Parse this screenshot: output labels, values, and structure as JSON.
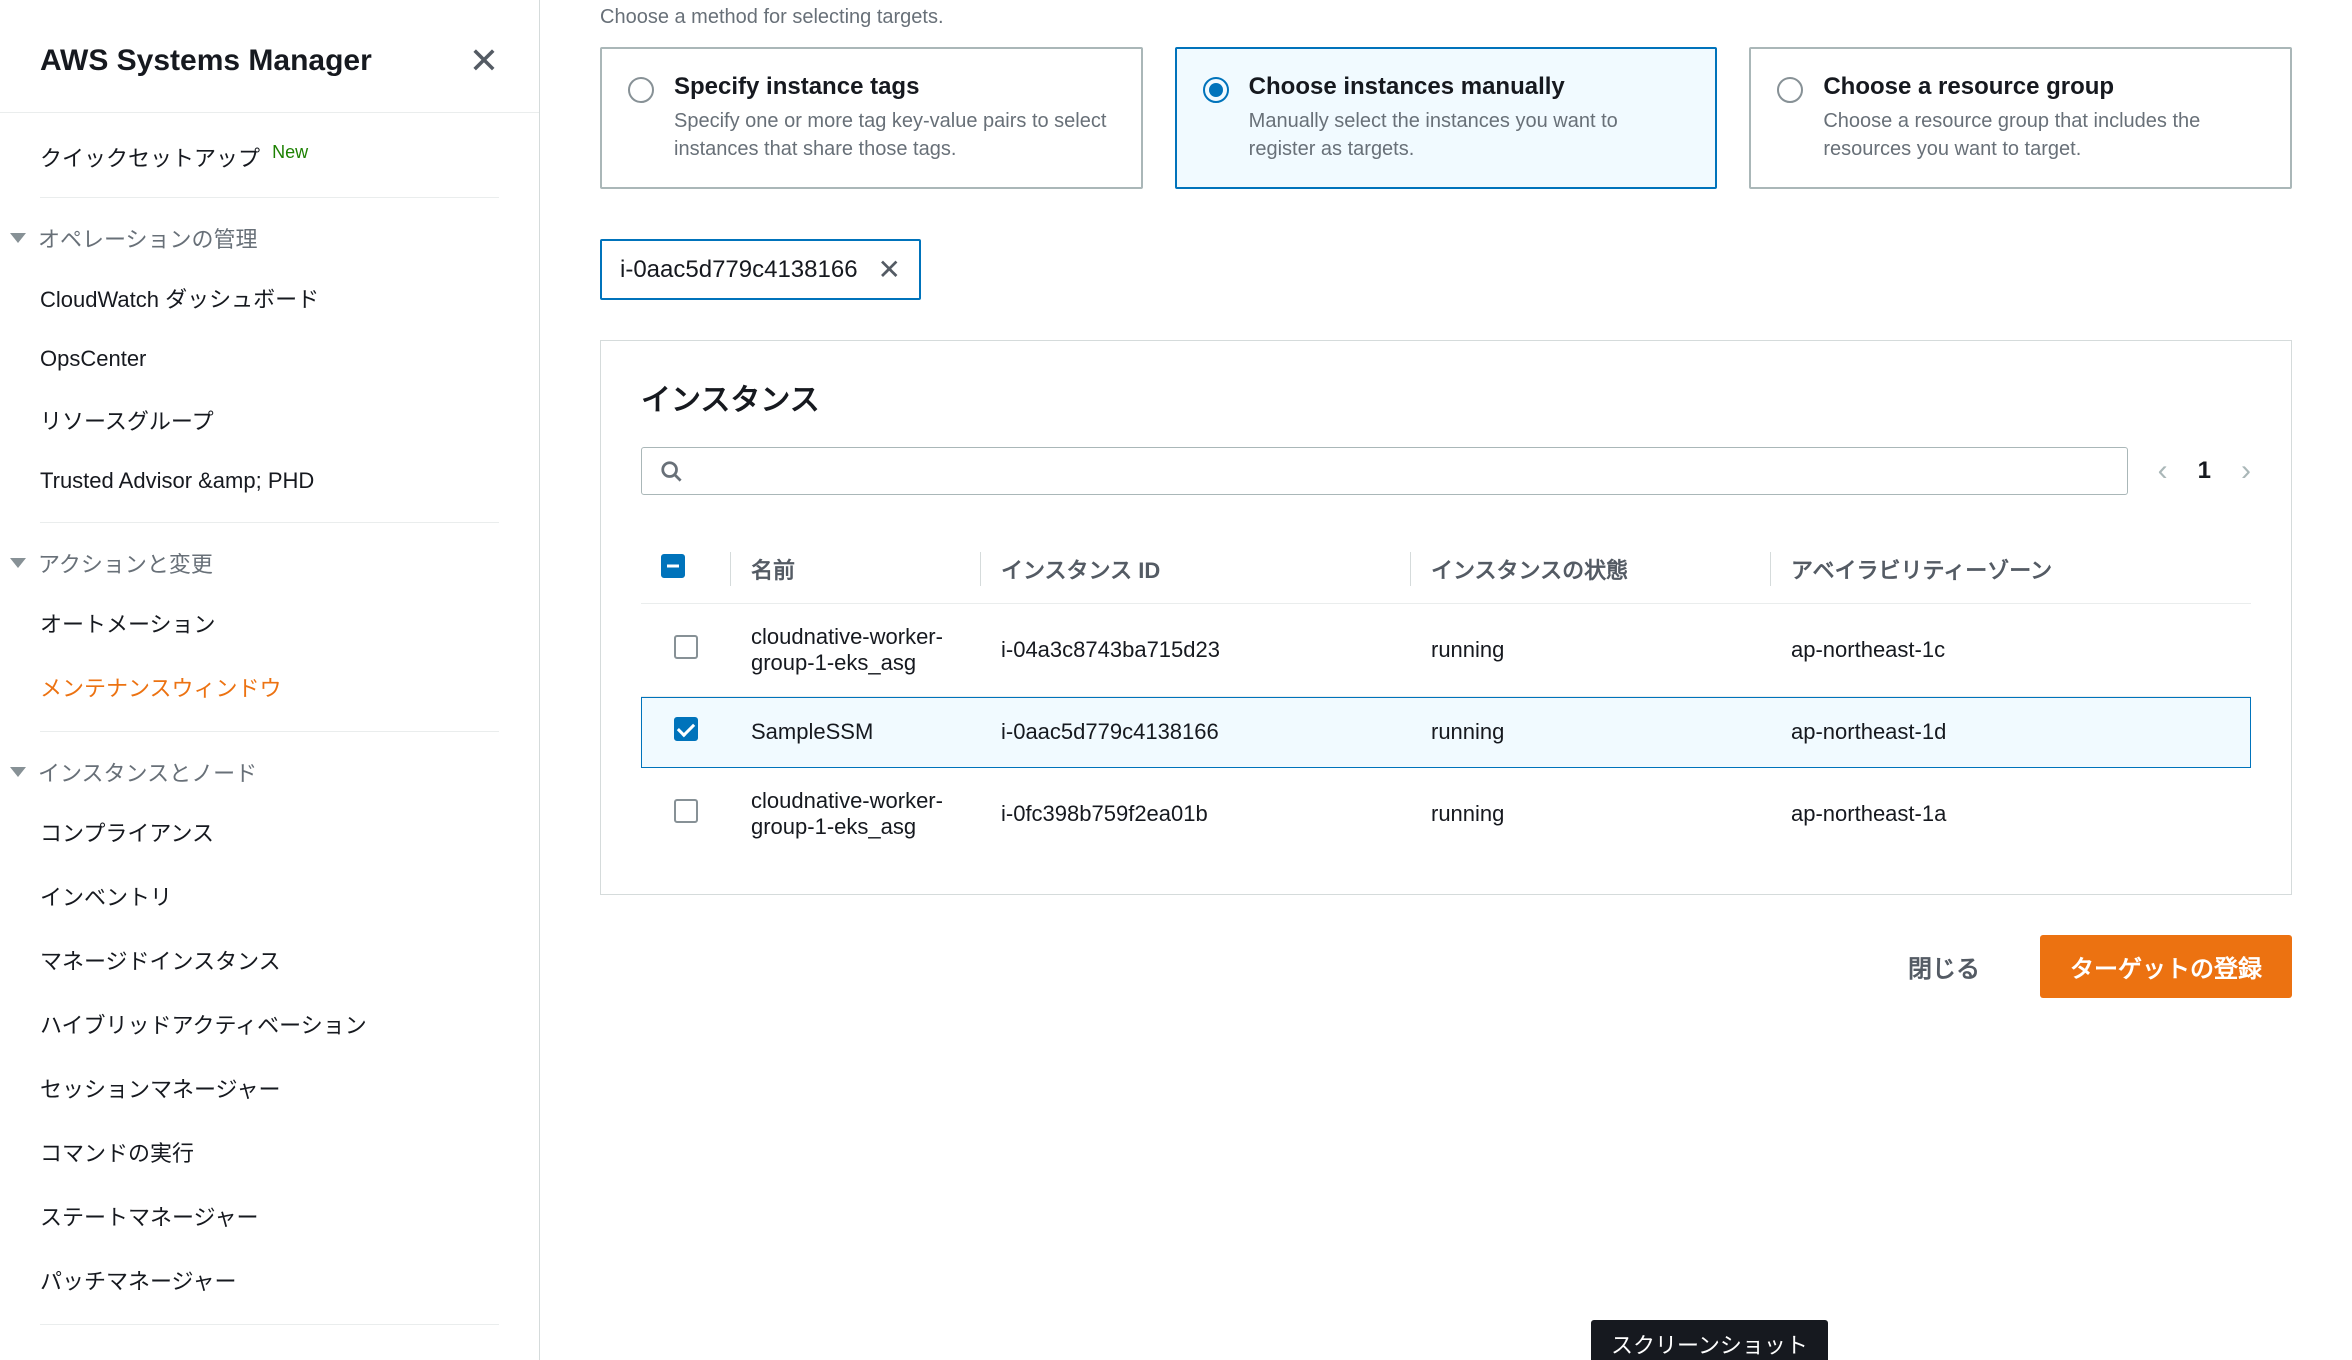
{
  "sidebar": {
    "title": "AWS Systems Manager",
    "quick_setup": "クイックセットアップ",
    "quick_setup_badge": "New",
    "sections": [
      {
        "label": "オペレーションの管理",
        "items": [
          "CloudWatch ダッシュボード",
          "OpsCenter",
          "リソースグループ",
          "Trusted Advisor &amp; PHD"
        ]
      },
      {
        "label": "アクションと変更",
        "items": [
          "オートメーション",
          "メンテナンスウィンドウ"
        ],
        "active_index": 1
      },
      {
        "label": "インスタンスとノード",
        "items": [
          "コンプライアンス",
          "インベントリ",
          "マネージドインスタンス",
          "ハイブリッドアクティベーション",
          "セッションマネージャー",
          "コマンドの実行",
          "ステートマネージャー",
          "パッチマネージャー"
        ]
      }
    ]
  },
  "main": {
    "hint": "Choose a method for selecting targets.",
    "cards": [
      {
        "title": "Specify instance tags",
        "desc": "Specify one or more tag key-value pairs to select instances that share those tags.",
        "selected": false
      },
      {
        "title": "Choose instances manually",
        "desc": "Manually select the instances you want to register as targets.",
        "selected": true
      },
      {
        "title": "Choose a resource group",
        "desc": "Choose a resource group that includes the resources you want to target.",
        "selected": false
      }
    ],
    "token": "i-0aac5d779c4138166",
    "panel_title": "インスタンス",
    "page": "1",
    "table": {
      "headers": [
        "名前",
        "インスタンス ID",
        "インスタンスの状態",
        "アベイラビリティーゾーン"
      ],
      "rows": [
        {
          "checked": false,
          "name": "cloudnative-worker-group-1-eks_asg",
          "id": "i-04a3c8743ba715d23",
          "state": "running",
          "az": "ap-northeast-1c"
        },
        {
          "checked": true,
          "name": "SampleSSM",
          "id": "i-0aac5d779c4138166",
          "state": "running",
          "az": "ap-northeast-1d"
        },
        {
          "checked": false,
          "name": "cloudnative-worker-group-1-eks_asg",
          "id": "i-0fc398b759f2ea01b",
          "state": "running",
          "az": "ap-northeast-1a"
        }
      ]
    },
    "footer": {
      "cancel": "閉じる",
      "submit": "ターゲットの登録"
    },
    "tooltip": "スクリーンショット"
  }
}
